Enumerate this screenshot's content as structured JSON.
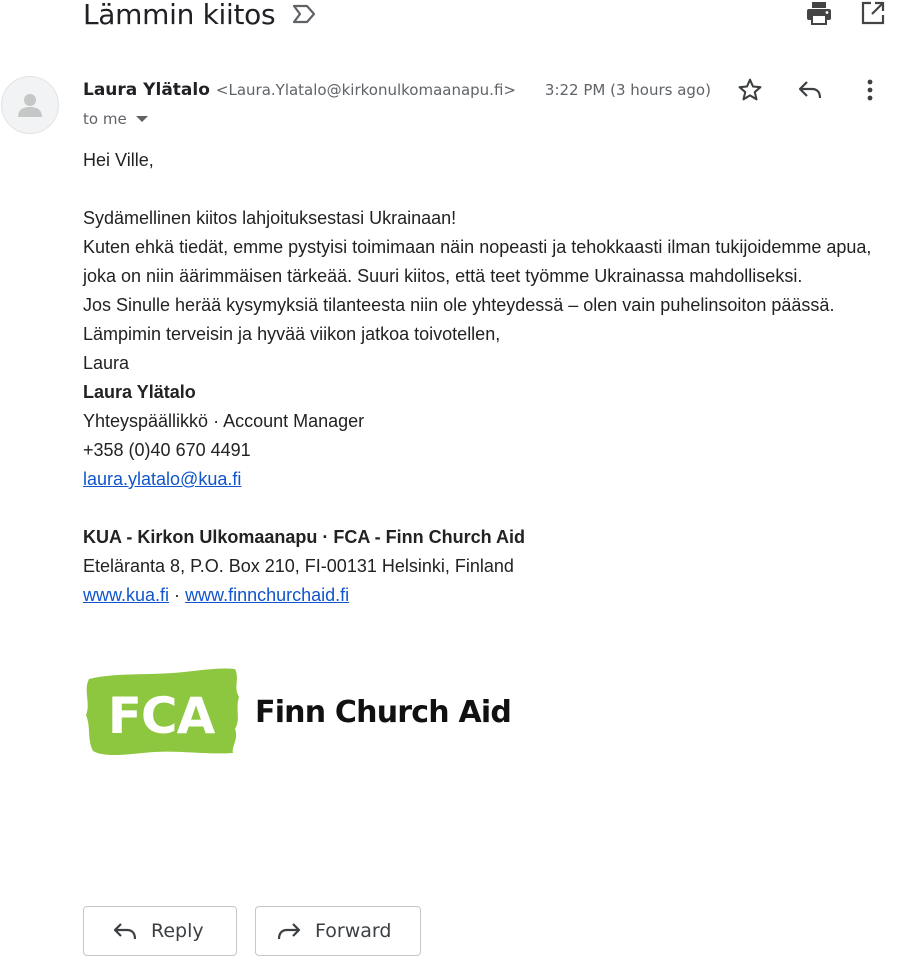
{
  "email": {
    "subject": "Lämmin kiitos",
    "sender_name": "Laura Ylätalo",
    "sender_email": "<Laura.Ylatalo@kirkonulkomaanapu.fi>",
    "timestamp": "3:22 PM (3 hours ago)",
    "recipient": "to me",
    "greeting": "Hei Ville,",
    "lines": [
      "Sydämellinen kiitos lahjoituksestasi Ukrainaan!",
      "Kuten ehkä tiedät, emme pystyisi toimimaan näin nopeasti ja tehokkaasti ilman tukijoidemme apua, joka on niin äärimmäisen tärkeää. Suuri kiitos, että teet työmme Ukrainassa mahdolliseksi.",
      "Jos Sinulle herää kysymyksiä tilanteesta niin ole yhteydessä – olen vain puhelinsoiton päässä.",
      "Lämpimin terveisin ja hyvää viikon jatkoa toivotellen,",
      "Laura"
    ],
    "signature": {
      "name": "Laura Ylätalo",
      "title": "Yhteyspäällikkö · Account Manager",
      "phone": "+358 (0)40 670 4491",
      "email": "laura.ylatalo@kua.fi",
      "org": "KUA - Kirkon Ulkomaanapu · FCA - Finn Church Aid",
      "address": "Eteläranta 8, P.O. Box 210, FI-00131 Helsinki, Finland",
      "link1": "www.kua.fi",
      "link_sep": "·",
      "link2": "www.finnchurchaid.fi"
    },
    "logo": {
      "mark": "FCA",
      "text": "Finn Church Aid",
      "color": "#8dc63f"
    }
  },
  "actions": {
    "reply": "Reply",
    "forward": "Forward"
  },
  "icons": {
    "label": "label-outline-icon",
    "print": "print-icon",
    "open_new": "open-in-new-icon",
    "star": "star-outline-icon",
    "reply": "reply-icon",
    "more": "more-vert-icon",
    "avatar": "person-icon",
    "forward": "forward-icon"
  }
}
